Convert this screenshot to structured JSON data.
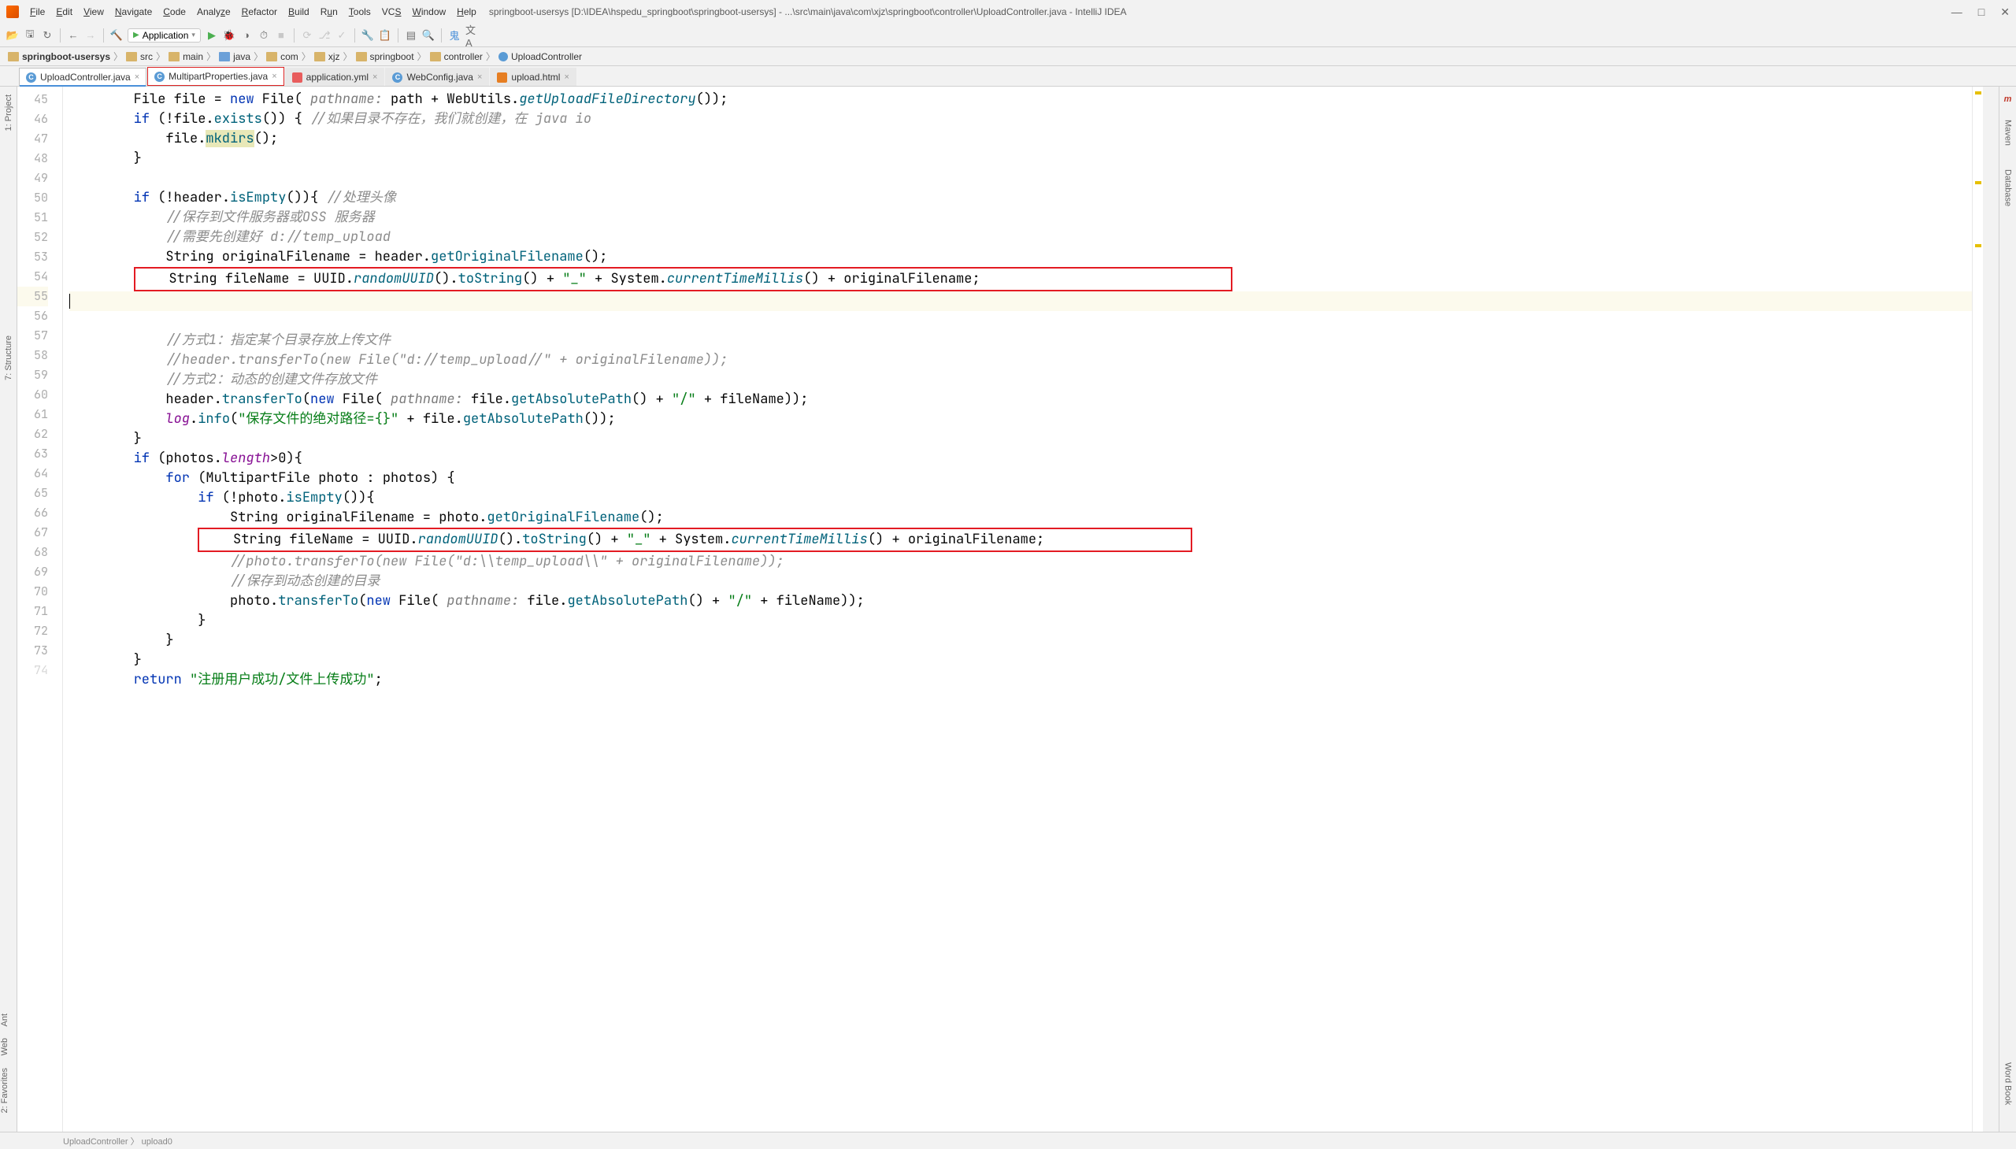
{
  "window": {
    "title": "springboot-usersys [D:\\IDEA\\hspedu_springboot\\springboot-usersys] - ...\\src\\main\\java\\com\\xjz\\springboot\\controller\\UploadController.java - IntelliJ IDEA"
  },
  "menu": {
    "file": "File",
    "edit": "Edit",
    "view": "View",
    "navigate": "Navigate",
    "code": "Code",
    "analyze": "Analyze",
    "refactor": "Refactor",
    "build": "Build",
    "run": "Run",
    "tools": "Tools",
    "vcs": "VCS",
    "window": "Window",
    "help": "Help"
  },
  "run_config": {
    "name": "Application"
  },
  "breadcrumb": {
    "items": [
      "springboot-usersys",
      "src",
      "main",
      "java",
      "com",
      "xjz",
      "springboot",
      "controller",
      "UploadController"
    ]
  },
  "tabs": [
    {
      "label": "UploadController.java",
      "type": "java",
      "active": true,
      "underlined": true
    },
    {
      "label": "MultipartProperties.java",
      "type": "java",
      "highlighted": true
    },
    {
      "label": "application.yml",
      "type": "yml"
    },
    {
      "label": "WebConfig.java",
      "type": "java"
    },
    {
      "label": "upload.html",
      "type": "html"
    }
  ],
  "gutter": {
    "start": 45,
    "end": 74
  },
  "code_status": {
    "crumb1": "UploadController",
    "crumb2": "upload0"
  },
  "left_rail": {
    "project": "1: Project",
    "structure": "7: Structure"
  },
  "left_bottom": {
    "web": "Web",
    "ant": "Ant",
    "fav": "2: Favorites"
  },
  "right_rail": {
    "maven": "Maven",
    "database": "Database",
    "word": "Word Book"
  }
}
